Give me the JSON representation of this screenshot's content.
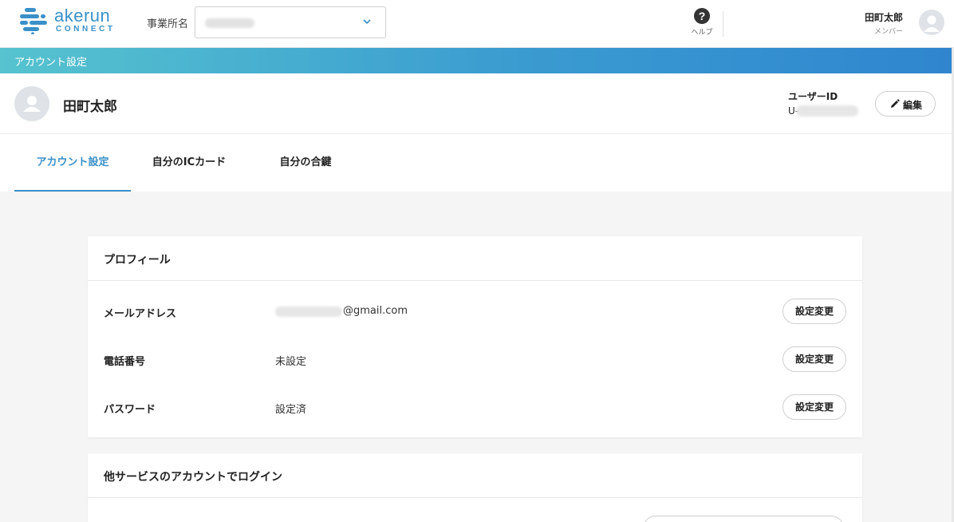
{
  "header": {
    "logo_word": "akerun",
    "logo_sub": "CONNECT",
    "office_label": "事業所名",
    "help_label": "ヘルプ",
    "user_name": "田町太郎",
    "user_role": "メンバー"
  },
  "banner": {
    "title": "アカウント設定"
  },
  "profile": {
    "name": "田町太郎",
    "user_id_label": "ユーザーID",
    "user_id_prefix": "U-",
    "edit_label": "編集"
  },
  "tabs": [
    {
      "label": "アカウント設定",
      "active": true
    },
    {
      "label": "自分のICカード",
      "active": false
    },
    {
      "label": "自分の合鍵",
      "active": false
    }
  ],
  "profile_card": {
    "title": "プロフィール",
    "rows": [
      {
        "label": "メールアドレス",
        "value": "@gmail.com",
        "button": "設定変更"
      },
      {
        "label": "電話番号",
        "value": "未設定",
        "button": "設定変更"
      },
      {
        "label": "パスワード",
        "value": "設定済",
        "button": "設定変更"
      }
    ]
  },
  "login_card": {
    "title": "他サービスのアカウントでログイン"
  },
  "colors": {
    "accent": "#3a90c8",
    "banner_start": "#56c3cf",
    "banner_end": "#2f86cf"
  }
}
